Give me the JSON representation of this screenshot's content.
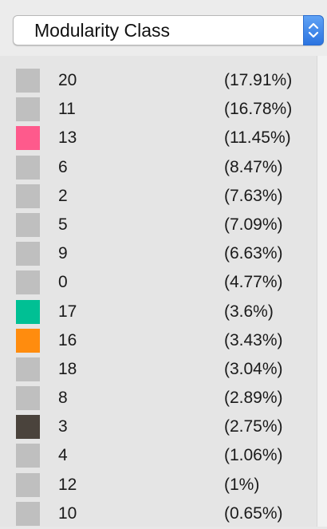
{
  "dropdown": {
    "selected": "Modularity Class"
  },
  "legend": {
    "default_color": "#bfbfbf",
    "rows": [
      {
        "label": "20",
        "percent": "(17.91%)",
        "color": "#bfbfbf"
      },
      {
        "label": "11",
        "percent": "(16.78%)",
        "color": "#bfbfbf"
      },
      {
        "label": "13",
        "percent": "(11.45%)",
        "color": "#fe5a8c"
      },
      {
        "label": "6",
        "percent": "(8.47%)",
        "color": "#bfbfbf"
      },
      {
        "label": "2",
        "percent": "(7.63%)",
        "color": "#bfbfbf"
      },
      {
        "label": "5",
        "percent": "(7.09%)",
        "color": "#bfbfbf"
      },
      {
        "label": "9",
        "percent": "(6.63%)",
        "color": "#bfbfbf"
      },
      {
        "label": "0",
        "percent": "(4.77%)",
        "color": "#bfbfbf"
      },
      {
        "label": "17",
        "percent": "(3.6%)",
        "color": "#00c094"
      },
      {
        "label": "16",
        "percent": "(3.43%)",
        "color": "#ff8c0e"
      },
      {
        "label": "18",
        "percent": "(3.04%)",
        "color": "#bfbfbf"
      },
      {
        "label": "8",
        "percent": "(2.89%)",
        "color": "#bfbfbf"
      },
      {
        "label": "3",
        "percent": "(2.75%)",
        "color": "#4a433c"
      },
      {
        "label": "4",
        "percent": "(1.06%)",
        "color": "#bfbfbf"
      },
      {
        "label": "12",
        "percent": "(1%)",
        "color": "#bfbfbf"
      },
      {
        "label": "10",
        "percent": "(0.65%)",
        "color": "#bfbfbf"
      }
    ]
  }
}
